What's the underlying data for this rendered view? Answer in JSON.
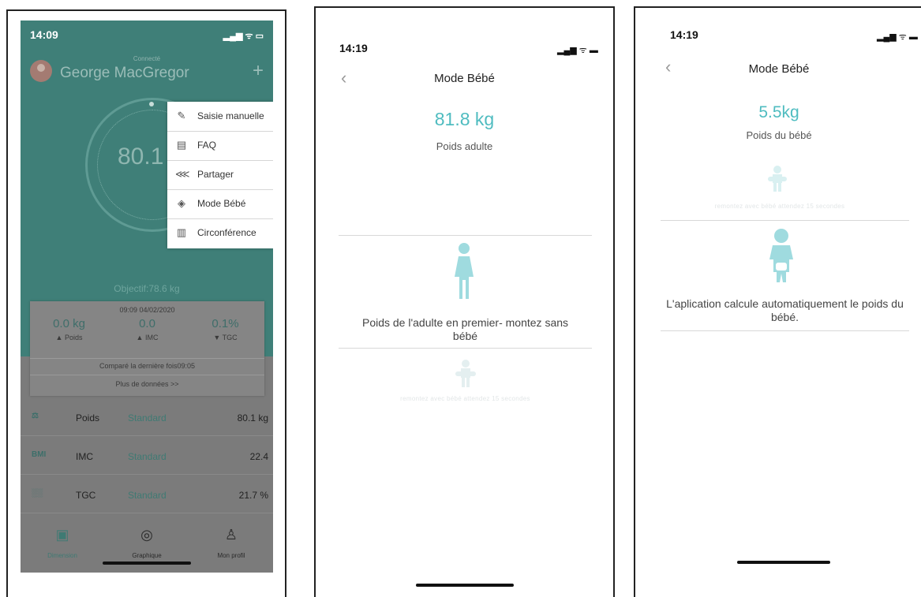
{
  "screen1": {
    "status": {
      "time": "14:09",
      "icons": "▂▄▆ ᯤ ▭"
    },
    "header": {
      "connected": "Connecté",
      "user_name": "George MacGregor",
      "plus": "+"
    },
    "gauge": {
      "value": "80.1"
    },
    "menu": [
      {
        "icon": "✎",
        "label": "Saisie manuelle"
      },
      {
        "icon": "▤",
        "label": "FAQ"
      },
      {
        "icon": "⋘",
        "label": "Partager"
      },
      {
        "icon": "◈",
        "label": "Mode Bébé"
      },
      {
        "icon": "▥",
        "label": "Circonférence"
      }
    ],
    "objective": "Objectif:78.6 kg",
    "summary": {
      "datetime": "09:09 04/02/2020",
      "cols": [
        {
          "value": "0.0 kg",
          "label": "▲ Poids"
        },
        {
          "value": "0.0",
          "label": "▲ IMC"
        },
        {
          "value": "0.1%",
          "label": "▼ TGC"
        }
      ],
      "compare": "Comparé la dernière fois09:05",
      "more": "Plus de données >>"
    },
    "metrics": [
      {
        "icon": "⚖",
        "name": "Poids",
        "status": "Standard",
        "value": "80.1 kg"
      },
      {
        "icon": "BMI",
        "name": "IMC",
        "status": "Standard",
        "value": "22.4"
      },
      {
        "icon": "░░",
        "name": "TGC",
        "status": "Standard",
        "value": "21.7 %"
      }
    ],
    "tabs": [
      {
        "icon": "▣",
        "label": "Dimension"
      },
      {
        "icon": "◎",
        "label": "Graphique"
      },
      {
        "icon": "♙",
        "label": "Mon profil"
      }
    ]
  },
  "screen2": {
    "status": {
      "time": "14:19",
      "icons": "▂▄▆ ᯤ ▬"
    },
    "back": "‹",
    "title": "Mode Bébé",
    "weight": "81.8 kg",
    "weight_label": "Poids adulte",
    "instruction": "Poids de l'adulte en premier- montez sans bébé",
    "faint_instruction": "remontez avec bébé attendez 15 secondes"
  },
  "screen3": {
    "status": {
      "time": "14:19",
      "icons": "▂▄▆ ᯤ ▬"
    },
    "back": "‹",
    "title": "Mode Bébé",
    "weight": "5.5kg",
    "weight_label": "Poids du bébé",
    "faint_instruction": "remontez avec bébé attendez 15 secondes",
    "instruction": "L'aplication calcule automatiquement le poids du bébé."
  },
  "colors": {
    "teal": "#3f7f78",
    "accent": "#4fbcc0",
    "figure": "#9fdbdf",
    "figure_faint": "#d9f0f1"
  }
}
